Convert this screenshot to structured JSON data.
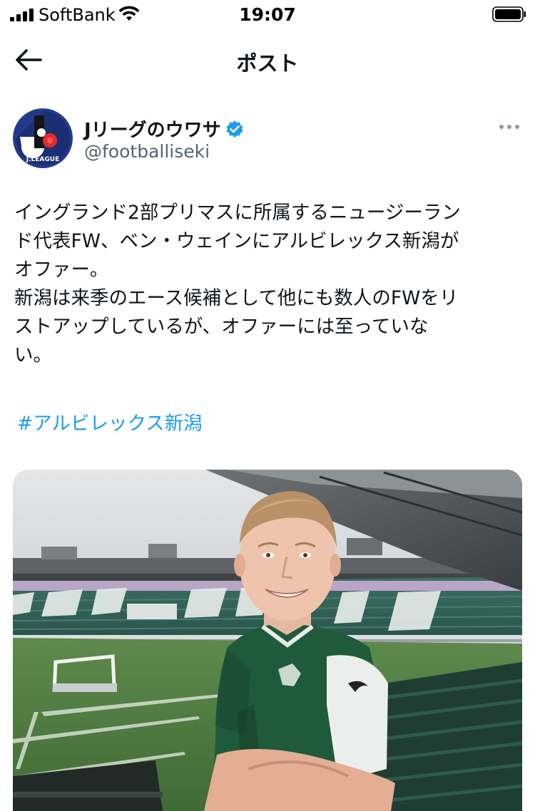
{
  "status_bar": {
    "carrier": "SoftBank",
    "time": "19:07"
  },
  "nav": {
    "title": "ポスト",
    "back_icon": "arrow-left-icon"
  },
  "author": {
    "display_name": "Jリーグのウワサ",
    "handle": "@footballiseki",
    "verified": true,
    "avatar_text": "J.LEAGUE"
  },
  "post": {
    "text": "イングランド2部プリマスに所属するニュージーラン\nド代表FW、ベン・ウェインにアルビレックス新潟が\nオファー。\n新潟は来季のエース候補として他にも数人のFWをリ\nストアップしているが、オファーには至っていな\nい。",
    "hashtag": "#アルビレックス新潟"
  },
  "colors": {
    "accent": "#1d9bf0",
    "secondary_text": "#536471",
    "jersey_green": "#1f5a3a"
  }
}
